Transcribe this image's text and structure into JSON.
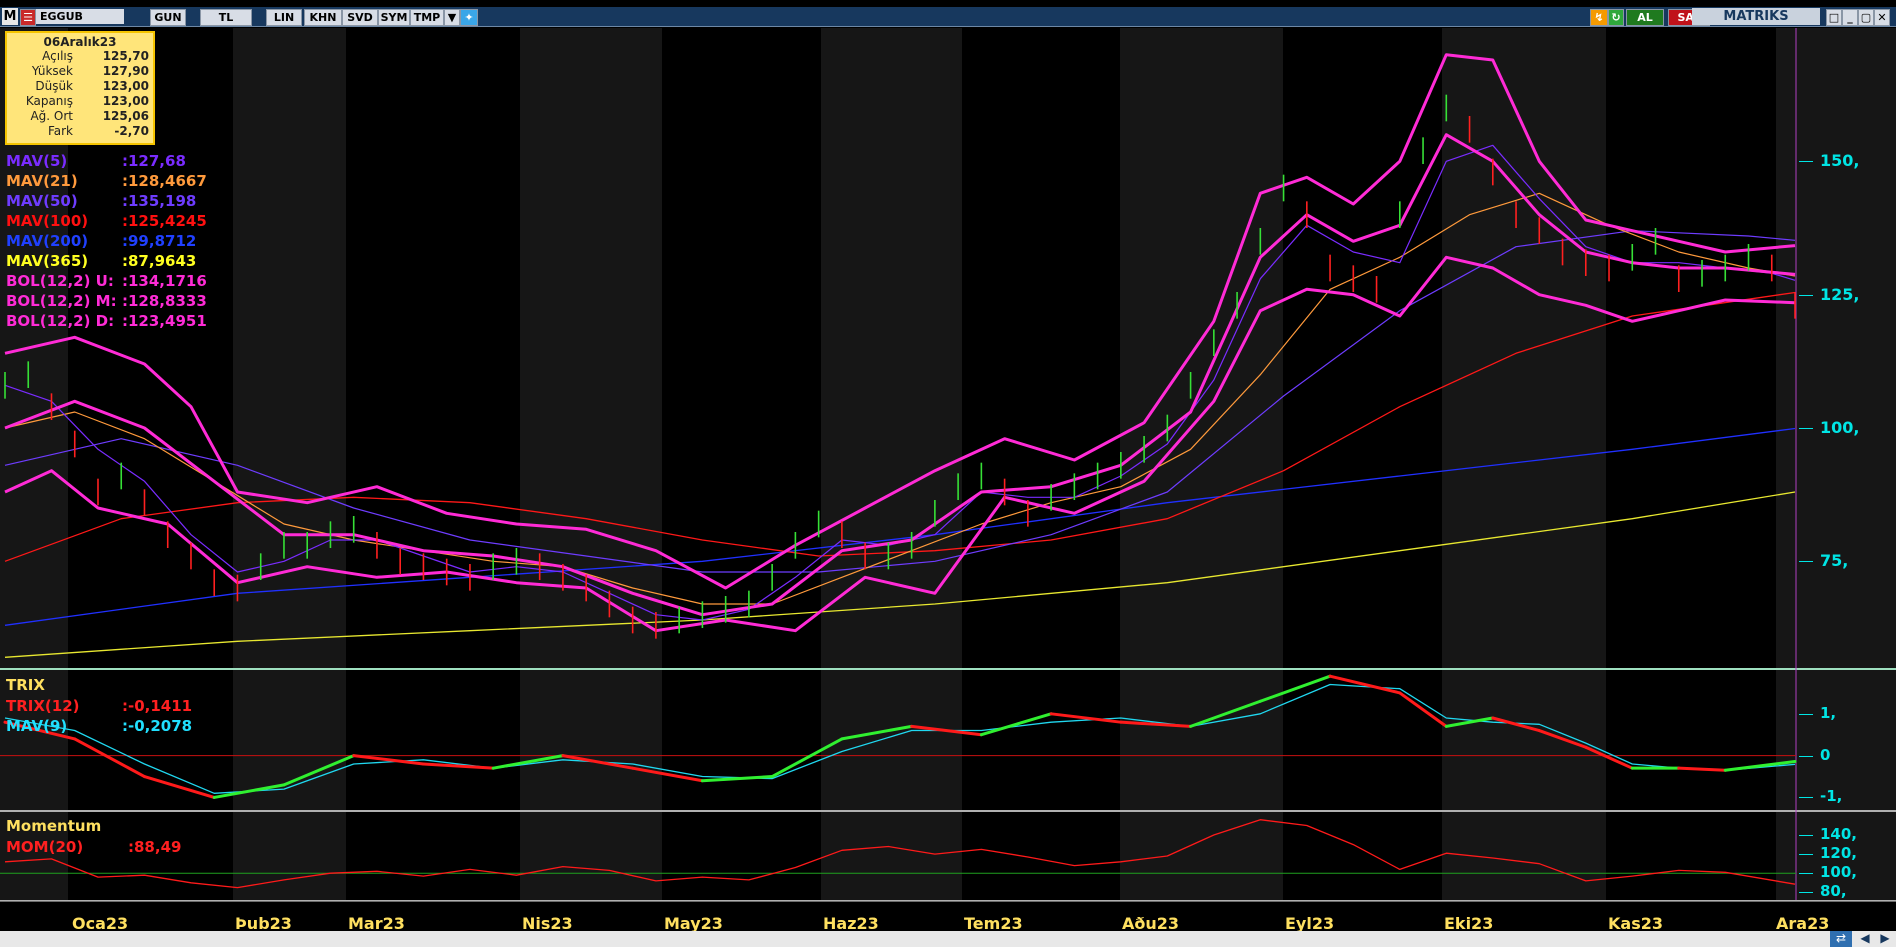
{
  "toolbar": {
    "menu": "M",
    "symbol": "EGGUB",
    "buttons": [
      "GUN",
      "TL",
      "LIN",
      "KHN",
      "SVD",
      "SYM",
      "TMP"
    ],
    "buy_label": "AL",
    "sell_label": "SAT",
    "brand": "MATRIKS"
  },
  "ohlc": {
    "date": "06Aralık23",
    "rows": [
      {
        "label": "Açılış",
        "value": "125,70"
      },
      {
        "label": "Yüksek",
        "value": "127,90"
      },
      {
        "label": "Düşük",
        "value": "123,00"
      },
      {
        "label": "Kapanış",
        "value": "123,00"
      },
      {
        "label": "Ağ. Ort",
        "value": "125,06"
      },
      {
        "label": "Fark",
        "value": "-2,70"
      }
    ]
  },
  "indicators": [
    {
      "name": "MAV(5)",
      "value": ":127,68",
      "color": "#7a2cff"
    },
    {
      "name": "MAV(21)",
      "value": ":128,4667",
      "color": "#ff9a3c"
    },
    {
      "name": "MAV(50)",
      "value": ":135,198",
      "color": "#6e3cff"
    },
    {
      "name": "MAV(100)",
      "value": ":125,4245",
      "color": "#ff1010"
    },
    {
      "name": "MAV(200)",
      "value": ":99,8712",
      "color": "#2040ff"
    },
    {
      "name": "MAV(365)",
      "value": ":87,9643",
      "color": "#ffff20"
    },
    {
      "name": "BOL(12,2) U:",
      "value": ":134,1716",
      "color": "#ff2bd6"
    },
    {
      "name": "BOL(12,2) M:",
      "value": ":128,8333",
      "color": "#ff2bd6"
    },
    {
      "name": "BOL(12,2) D:",
      "value": ":123,4951",
      "color": "#ff2bd6"
    }
  ],
  "trix_panel": {
    "title": "TRIX",
    "rows": [
      {
        "name": "TRIX(12)",
        "value": ":-0,1411",
        "color": "#ff2020"
      },
      {
        "name": "MAV(9)",
        "value": ":-0,2078",
        "color": "#20e0ff"
      }
    ]
  },
  "momentum_panel": {
    "title": "Momentum",
    "rows": [
      {
        "name": "MOM(20)",
        "value": ":88,49",
        "color": "#ff2020"
      }
    ]
  },
  "chart_data": {
    "type": "line",
    "price_axis": {
      "ticks": [
        "150,",
        "125,",
        "100,",
        "75,"
      ],
      "values": [
        150,
        125,
        100,
        75
      ],
      "ylim": [
        55,
        175
      ]
    },
    "trix_axis": {
      "ticks": [
        "1,",
        "0",
        "-1,"
      ],
      "values": [
        1,
        0,
        -1
      ],
      "ylim": [
        -1.3,
        2.0
      ]
    },
    "momentum_axis": {
      "ticks": [
        "140,",
        "120,",
        "100,",
        "80,"
      ],
      "values": [
        140,
        120,
        100,
        80
      ],
      "ylim": [
        72,
        162
      ]
    },
    "months": [
      "Oca23",
      "Şub23",
      "Mar23",
      "Nis23",
      "May23",
      "Haz23",
      "Tem23",
      "Ağu23",
      "Eyl23",
      "Eki23",
      "Kas23",
      "Ara23"
    ],
    "month_axis_labels": [
      "Oca23",
      "Þub23",
      "Mar23",
      "Nis23",
      "May23",
      "Haz23",
      "Tem23",
      "Aðu23",
      "Eyl23",
      "Eki23",
      "Kas23",
      "Ara23"
    ],
    "close": [
      [
        0,
        108
      ],
      [
        1,
        110
      ],
      [
        2,
        104
      ],
      [
        3,
        97
      ],
      [
        4,
        88
      ],
      [
        5,
        91
      ],
      [
        6,
        86
      ],
      [
        7,
        80
      ],
      [
        8,
        76
      ],
      [
        9,
        71
      ],
      [
        10,
        70
      ],
      [
        11,
        74
      ],
      [
        12,
        78
      ],
      [
        13,
        78
      ],
      [
        14,
        80
      ],
      [
        15,
        81
      ],
      [
        16,
        78
      ],
      [
        17,
        75
      ],
      [
        18,
        74
      ],
      [
        19,
        73
      ],
      [
        20,
        72
      ],
      [
        21,
        74
      ],
      [
        22,
        75
      ],
      [
        23,
        74
      ],
      [
        24,
        72
      ],
      [
        25,
        70
      ],
      [
        26,
        67
      ],
      [
        27,
        64
      ],
      [
        28,
        63
      ],
      [
        29,
        64
      ],
      [
        30,
        65
      ],
      [
        31,
        66
      ],
      [
        32,
        67
      ],
      [
        33,
        72
      ],
      [
        34,
        78
      ],
      [
        35,
        82
      ],
      [
        36,
        80
      ],
      [
        37,
        76
      ],
      [
        38,
        76
      ],
      [
        39,
        78
      ],
      [
        40,
        84
      ],
      [
        41,
        89
      ],
      [
        42,
        91
      ],
      [
        43,
        88
      ],
      [
        44,
        84
      ],
      [
        45,
        87
      ],
      [
        46,
        89
      ],
      [
        47,
        91
      ],
      [
        48,
        93
      ],
      [
        49,
        96
      ],
      [
        50,
        100
      ],
      [
        51,
        108
      ],
      [
        52,
        116
      ],
      [
        53,
        123
      ],
      [
        54,
        135
      ],
      [
        55,
        145
      ],
      [
        56,
        140
      ],
      [
        57,
        130
      ],
      [
        58,
        128
      ],
      [
        59,
        126
      ],
      [
        60,
        140
      ],
      [
        61,
        152
      ],
      [
        62,
        160
      ],
      [
        63,
        156
      ],
      [
        64,
        148
      ],
      [
        65,
        140
      ],
      [
        66,
        137
      ],
      [
        67,
        133
      ],
      [
        68,
        131
      ],
      [
        69,
        130
      ],
      [
        70,
        132
      ],
      [
        71,
        135
      ],
      [
        72,
        128
      ],
      [
        73,
        129
      ],
      [
        74,
        130
      ],
      [
        75,
        132
      ],
      [
        76,
        130
      ],
      [
        77,
        123
      ]
    ],
    "sma_5": [
      [
        0,
        108
      ],
      [
        2,
        105
      ],
      [
        4,
        96
      ],
      [
        6,
        90
      ],
      [
        8,
        80
      ],
      [
        10,
        73
      ],
      [
        12,
        75
      ],
      [
        14,
        79
      ],
      [
        16,
        79
      ],
      [
        18,
        76
      ],
      [
        20,
        73
      ],
      [
        22,
        74
      ],
      [
        24,
        73
      ],
      [
        26,
        69
      ],
      [
        28,
        65
      ],
      [
        30,
        64
      ],
      [
        32,
        66
      ],
      [
        34,
        72
      ],
      [
        36,
        79
      ],
      [
        38,
        78
      ],
      [
        40,
        80
      ],
      [
        42,
        88
      ],
      [
        44,
        87
      ],
      [
        46,
        87
      ],
      [
        48,
        91
      ],
      [
        50,
        97
      ],
      [
        52,
        109
      ],
      [
        54,
        128
      ],
      [
        56,
        138
      ],
      [
        58,
        133
      ],
      [
        60,
        131
      ],
      [
        62,
        150
      ],
      [
        64,
        153
      ],
      [
        66,
        143
      ],
      [
        68,
        134
      ],
      [
        70,
        131
      ],
      [
        72,
        131
      ],
      [
        74,
        130
      ],
      [
        76,
        129
      ],
      [
        77,
        127.7
      ]
    ],
    "sma_21": [
      [
        0,
        100
      ],
      [
        3,
        103
      ],
      [
        6,
        98
      ],
      [
        9,
        90
      ],
      [
        12,
        82
      ],
      [
        15,
        79
      ],
      [
        18,
        77
      ],
      [
        21,
        75
      ],
      [
        24,
        74
      ],
      [
        27,
        70
      ],
      [
        30,
        67
      ],
      [
        33,
        67
      ],
      [
        36,
        72
      ],
      [
        39,
        77
      ],
      [
        42,
        82
      ],
      [
        45,
        86
      ],
      [
        48,
        89
      ],
      [
        51,
        96
      ],
      [
        54,
        110
      ],
      [
        57,
        126
      ],
      [
        60,
        132
      ],
      [
        63,
        140
      ],
      [
        66,
        144
      ],
      [
        69,
        138
      ],
      [
        72,
        133
      ],
      [
        75,
        130
      ],
      [
        77,
        128.5
      ]
    ],
    "sma_50": [
      [
        0,
        93
      ],
      [
        5,
        98
      ],
      [
        10,
        93
      ],
      [
        15,
        85
      ],
      [
        20,
        79
      ],
      [
        25,
        76
      ],
      [
        30,
        73
      ],
      [
        35,
        73
      ],
      [
        40,
        75
      ],
      [
        45,
        80
      ],
      [
        50,
        88
      ],
      [
        55,
        106
      ],
      [
        60,
        122
      ],
      [
        65,
        134
      ],
      [
        70,
        137
      ],
      [
        75,
        136
      ],
      [
        77,
        135.2
      ]
    ],
    "sma_100": [
      [
        0,
        75
      ],
      [
        5,
        83
      ],
      [
        10,
        86
      ],
      [
        15,
        87
      ],
      [
        20,
        86
      ],
      [
        25,
        83
      ],
      [
        30,
        79
      ],
      [
        35,
        76
      ],
      [
        40,
        77
      ],
      [
        45,
        79
      ],
      [
        50,
        83
      ],
      [
        55,
        92
      ],
      [
        60,
        104
      ],
      [
        65,
        114
      ],
      [
        70,
        121
      ],
      [
        77,
        125.4
      ]
    ],
    "sma_200": [
      [
        0,
        63
      ],
      [
        10,
        69
      ],
      [
        20,
        72
      ],
      [
        30,
        75
      ],
      [
        40,
        80
      ],
      [
        50,
        86
      ],
      [
        60,
        91
      ],
      [
        70,
        96
      ],
      [
        77,
        99.9
      ]
    ],
    "sma_365": [
      [
        0,
        57
      ],
      [
        10,
        60
      ],
      [
        20,
        62
      ],
      [
        30,
        64
      ],
      [
        40,
        67
      ],
      [
        50,
        71
      ],
      [
        60,
        77
      ],
      [
        70,
        83
      ],
      [
        77,
        88
      ]
    ],
    "bollinger_upper": [
      [
        0,
        114
      ],
      [
        3,
        117
      ],
      [
        6,
        112
      ],
      [
        8,
        104
      ],
      [
        10,
        88
      ],
      [
        13,
        86
      ],
      [
        16,
        89
      ],
      [
        19,
        84
      ],
      [
        22,
        82
      ],
      [
        25,
        81
      ],
      [
        28,
        77
      ],
      [
        31,
        70
      ],
      [
        34,
        78
      ],
      [
        37,
        85
      ],
      [
        40,
        92
      ],
      [
        43,
        98
      ],
      [
        46,
        94
      ],
      [
        49,
        101
      ],
      [
        52,
        120
      ],
      [
        54,
        144
      ],
      [
        56,
        147
      ],
      [
        58,
        142
      ],
      [
        60,
        150
      ],
      [
        62,
        170
      ],
      [
        64,
        169
      ],
      [
        66,
        150
      ],
      [
        68,
        139
      ],
      [
        70,
        137
      ],
      [
        72,
        135
      ],
      [
        74,
        133
      ],
      [
        77,
        134.2
      ]
    ],
    "bollinger_middle": [
      [
        0,
        100
      ],
      [
        3,
        105
      ],
      [
        6,
        100
      ],
      [
        9,
        90
      ],
      [
        12,
        80
      ],
      [
        15,
        80
      ],
      [
        18,
        77
      ],
      [
        21,
        76
      ],
      [
        24,
        74
      ],
      [
        27,
        69
      ],
      [
        30,
        65
      ],
      [
        33,
        67
      ],
      [
        36,
        77
      ],
      [
        39,
        79
      ],
      [
        42,
        88
      ],
      [
        45,
        89
      ],
      [
        48,
        93
      ],
      [
        51,
        103
      ],
      [
        54,
        132
      ],
      [
        56,
        140
      ],
      [
        58,
        135
      ],
      [
        60,
        138
      ],
      [
        62,
        155
      ],
      [
        64,
        150
      ],
      [
        66,
        140
      ],
      [
        68,
        133
      ],
      [
        70,
        131
      ],
      [
        72,
        130
      ],
      [
        74,
        130
      ],
      [
        77,
        128.8
      ]
    ],
    "bollinger_lower": [
      [
        0,
        88
      ],
      [
        2,
        92
      ],
      [
        4,
        85
      ],
      [
        7,
        82
      ],
      [
        10,
        71
      ],
      [
        13,
        74
      ],
      [
        16,
        72
      ],
      [
        19,
        73
      ],
      [
        22,
        71
      ],
      [
        25,
        70
      ],
      [
        28,
        62
      ],
      [
        31,
        64
      ],
      [
        34,
        62
      ],
      [
        37,
        72
      ],
      [
        40,
        69
      ],
      [
        43,
        87
      ],
      [
        46,
        84
      ],
      [
        49,
        90
      ],
      [
        52,
        105
      ],
      [
        54,
        122
      ],
      [
        56,
        126
      ],
      [
        58,
        125
      ],
      [
        60,
        121
      ],
      [
        62,
        132
      ],
      [
        64,
        130
      ],
      [
        66,
        125
      ],
      [
        68,
        123
      ],
      [
        70,
        120
      ],
      [
        72,
        122
      ],
      [
        74,
        124
      ],
      [
        77,
        123.5
      ]
    ],
    "trix": [
      [
        0,
        0.8
      ],
      [
        3,
        0.4
      ],
      [
        6,
        -0.5
      ],
      [
        9,
        -1.0
      ],
      [
        12,
        -0.7
      ],
      [
        15,
        0.0
      ],
      [
        18,
        -0.2
      ],
      [
        21,
        -0.3
      ],
      [
        24,
        0.0
      ],
      [
        27,
        -0.3
      ],
      [
        30,
        -0.6
      ],
      [
        33,
        -0.5
      ],
      [
        36,
        0.4
      ],
      [
        39,
        0.7
      ],
      [
        42,
        0.5
      ],
      [
        45,
        1.0
      ],
      [
        48,
        0.8
      ],
      [
        51,
        0.7
      ],
      [
        54,
        1.3
      ],
      [
        57,
        1.9
      ],
      [
        60,
        1.5
      ],
      [
        62,
        0.7
      ],
      [
        64,
        0.9
      ],
      [
        66,
        0.6
      ],
      [
        68,
        0.2
      ],
      [
        70,
        -0.3
      ],
      [
        72,
        -0.3
      ],
      [
        74,
        -0.35
      ],
      [
        77,
        -0.14
      ]
    ],
    "trix_signal": [
      [
        0,
        0.9
      ],
      [
        3,
        0.6
      ],
      [
        6,
        -0.2
      ],
      [
        9,
        -0.9
      ],
      [
        12,
        -0.8
      ],
      [
        15,
        -0.2
      ],
      [
        18,
        -0.1
      ],
      [
        21,
        -0.3
      ],
      [
        24,
        -0.1
      ],
      [
        27,
        -0.2
      ],
      [
        30,
        -0.5
      ],
      [
        33,
        -0.55
      ],
      [
        36,
        0.1
      ],
      [
        39,
        0.6
      ],
      [
        42,
        0.6
      ],
      [
        45,
        0.8
      ],
      [
        48,
        0.9
      ],
      [
        51,
        0.7
      ],
      [
        54,
        1.0
      ],
      [
        57,
        1.7
      ],
      [
        60,
        1.6
      ],
      [
        62,
        0.9
      ],
      [
        64,
        0.8
      ],
      [
        66,
        0.75
      ],
      [
        68,
        0.3
      ],
      [
        70,
        -0.2
      ],
      [
        72,
        -0.3
      ],
      [
        74,
        -0.35
      ],
      [
        77,
        -0.21
      ]
    ],
    "momentum": [
      [
        0,
        112
      ],
      [
        2,
        115
      ],
      [
        4,
        96
      ],
      [
        6,
        98
      ],
      [
        8,
        90
      ],
      [
        10,
        85
      ],
      [
        12,
        93
      ],
      [
        14,
        100
      ],
      [
        16,
        102
      ],
      [
        18,
        97
      ],
      [
        20,
        104
      ],
      [
        22,
        98
      ],
      [
        24,
        107
      ],
      [
        26,
        103
      ],
      [
        28,
        92
      ],
      [
        30,
        96
      ],
      [
        32,
        93
      ],
      [
        34,
        106
      ],
      [
        36,
        124
      ],
      [
        38,
        128
      ],
      [
        40,
        120
      ],
      [
        42,
        125
      ],
      [
        44,
        117
      ],
      [
        46,
        108
      ],
      [
        48,
        112
      ],
      [
        50,
        118
      ],
      [
        52,
        140
      ],
      [
        54,
        156
      ],
      [
        56,
        150
      ],
      [
        58,
        130
      ],
      [
        60,
        104
      ],
      [
        62,
        121
      ],
      [
        64,
        116
      ],
      [
        66,
        110
      ],
      [
        68,
        92
      ],
      [
        70,
        97
      ],
      [
        72,
        103
      ],
      [
        74,
        101
      ],
      [
        77,
        88.5
      ]
    ],
    "momentum_ref": 100,
    "trix_ref": 0
  }
}
